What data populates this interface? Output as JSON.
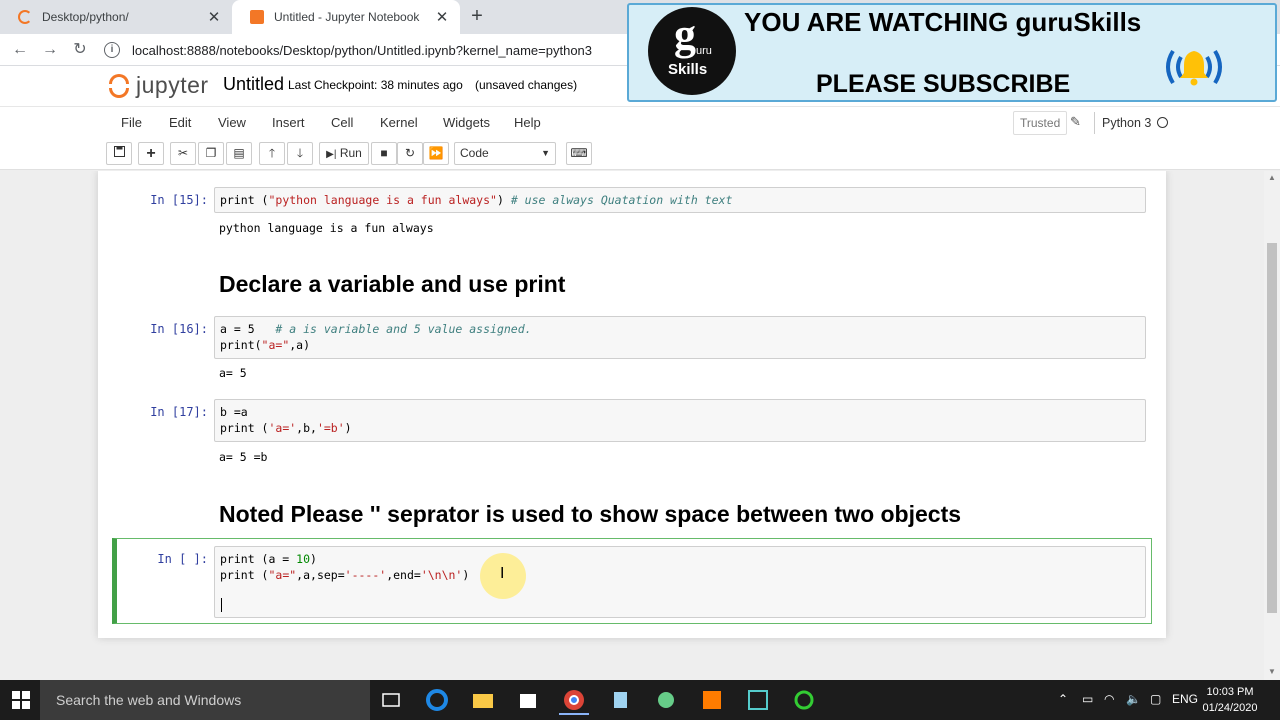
{
  "browser": {
    "tabs": [
      {
        "title": "Desktop/python/",
        "close": "✕"
      },
      {
        "title": "Untitled - Jupyter Notebook",
        "close": "✕"
      }
    ],
    "new_tab": "+",
    "url": "localhost:8888/notebooks/Desktop/python/Untitled.ipynb?kernel_name=python3"
  },
  "jupyter": {
    "logo_text": "jupyter",
    "notebook_name": "Untitled",
    "checkpoint": "Last Checkpoint: 38 minutes ago",
    "unsaved": "(unsaved changes)",
    "menu": [
      "File",
      "Edit",
      "View",
      "Insert",
      "Cell",
      "Kernel",
      "Widgets",
      "Help"
    ],
    "trusted": "Trusted",
    "kernel": "Python 3",
    "toolbar": {
      "run_label": "Run",
      "cell_type": "Code"
    }
  },
  "cells": {
    "c15": {
      "prompt": "In [15]:",
      "code": {
        "p1": "print (",
        "s1": "\"python language is a fun always\"",
        "p2": ") ",
        "cmt": "# use always Quatation with text"
      },
      "output": "python language is a fun always"
    },
    "md1": "Declare a variable and use print",
    "c16": {
      "prompt": "In [16]:",
      "line1a": "a = 5   ",
      "line1cmt": "# a is variable and 5 value assigned.",
      "line2a": "print(",
      "line2s": "\"a=\"",
      "line2b": ",a)",
      "output": "a= 5"
    },
    "c17": {
      "prompt": "In [17]:",
      "line1": "b =a",
      "line2a": "print (",
      "line2s1": "'a='",
      "line2b": ",b,",
      "line2s2": "'=b'",
      "line2c": ")",
      "output": "a= 5 =b"
    },
    "md2": "Noted Please '' seprator is used to show space between two objects",
    "active": {
      "prompt": "In [ ]:",
      "line1a": "print (a = ",
      "line1n": "10",
      "line1b": ")",
      "line2a": "print (",
      "line2s1": "\"a=\"",
      "line2b": ",a,sep=",
      "line2s2": "'----'",
      "line2c": ",end=",
      "line2s3": "'\\n\\n'",
      "line2d": ")"
    }
  },
  "banner": {
    "title": "YOU ARE WATCHING guruSkills",
    "subtitle": "PLEASE SUBSCRIBE",
    "logo_g": "g",
    "logo_uru": "uru",
    "logo_skills": "Skills"
  },
  "taskbar": {
    "search_placeholder": "Search the web and Windows",
    "lang": "ENG",
    "time": "10:03 PM",
    "date": "01/24/2020"
  },
  "colors": {
    "jupyter_orange": "#f37726",
    "prompt_blue": "#303f9f",
    "active_cell_green": "#42a047",
    "banner_bg": "#d7eef7"
  }
}
